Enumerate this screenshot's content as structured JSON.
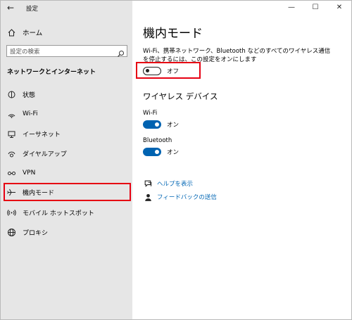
{
  "window": {
    "title": "設定",
    "back_glyph": "←",
    "controls": {
      "minimize": "—",
      "maximize": "☐",
      "close": "✕"
    }
  },
  "sidebar": {
    "home_label": "ホーム",
    "search_placeholder": "設定の検索",
    "section_title": "ネットワークとインターネット",
    "items": [
      {
        "label": "状態",
        "icon": "status-icon"
      },
      {
        "label": "Wi-Fi",
        "icon": "wifi-icon"
      },
      {
        "label": "イーサネット",
        "icon": "ethernet-icon"
      },
      {
        "label": "ダイヤルアップ",
        "icon": "dialup-icon"
      },
      {
        "label": "VPN",
        "icon": "vpn-icon"
      },
      {
        "label": "機内モード",
        "icon": "airplane-icon",
        "selected": true
      },
      {
        "label": "モバイル ホットスポット",
        "icon": "hotspot-icon"
      },
      {
        "label": "プロキシ",
        "icon": "globe-icon"
      }
    ]
  },
  "main": {
    "title": "機内モード",
    "description": "Wi-Fi、携帯ネットワーク、Bluetooth などのすべてのワイヤレス通信を停止するには、この設定をオンにします",
    "airplane_toggle": {
      "state": "off",
      "label": "オフ"
    },
    "wireless_heading": "ワイヤレス デバイス",
    "devices": [
      {
        "name": "Wi-Fi",
        "state": "on",
        "label": "オン"
      },
      {
        "name": "Bluetooth",
        "state": "on",
        "label": "オン"
      }
    ],
    "links": [
      {
        "label": "ヘルプを表示",
        "icon": "help-icon"
      },
      {
        "label": "フィードバックの送信",
        "icon": "feedback-icon"
      }
    ]
  },
  "colors": {
    "accent": "#0063b1",
    "highlight_box": "#e60012",
    "sidebar_bg": "#e6e6e6",
    "link": "#0066b4"
  }
}
